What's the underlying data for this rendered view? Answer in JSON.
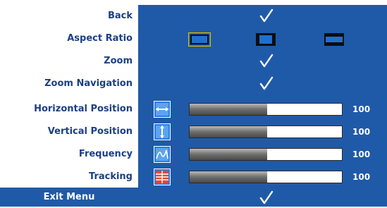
{
  "menu": {
    "items": [
      {
        "label": "Back",
        "type": "check"
      },
      {
        "label": "Aspect Ratio",
        "type": "aspect"
      },
      {
        "label": "Zoom",
        "type": "check"
      },
      {
        "label": "Zoom Navigation",
        "type": "check"
      },
      {
        "label": "Horizontal Position",
        "type": "slider",
        "value": "100",
        "fill": 0.51,
        "icon": "horizontal-position-icon"
      },
      {
        "label": "Vertical Position",
        "type": "slider",
        "value": "100",
        "fill": 0.51,
        "icon": "vertical-position-icon"
      },
      {
        "label": "Frequency",
        "type": "slider",
        "value": "100",
        "fill": 0.51,
        "icon": "frequency-icon"
      },
      {
        "label": "Tracking",
        "type": "slider",
        "value": "100",
        "fill": 0.51,
        "icon": "tracking-icon"
      }
    ],
    "exit_label": "Exit Menu",
    "aspect_options": [
      "aspect-ratio-original-icon",
      "aspect-ratio-4-3-icon",
      "aspect-ratio-wide-icon"
    ]
  },
  "colors": {
    "panel": "#1f5aa8",
    "label": "#1b3f86",
    "value": "#ffffff",
    "selected_outline": "#e6c200"
  }
}
